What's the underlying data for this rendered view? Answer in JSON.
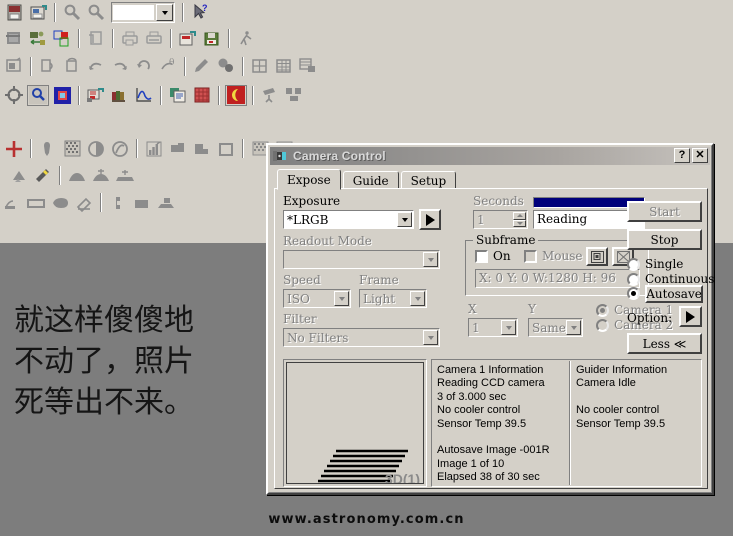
{
  "workspace": {
    "note_text": "就这样傻傻地\n不动了，照片\n死等出不来。",
    "watermark": "www.astronomy.com.cn"
  },
  "toolbar": {
    "rows": [
      {
        "items": [
          {
            "icon": "open-image-icon",
            "type": "btn"
          },
          {
            "icon": "save-image-icon",
            "type": "btn"
          },
          {
            "icon": "sep",
            "type": "sep"
          },
          {
            "icon": "zoom-out-icon",
            "type": "btn"
          },
          {
            "icon": "zoom-in-icon",
            "type": "btn"
          },
          {
            "icon": "zoom-level-combo",
            "type": "combo",
            "value": ""
          },
          {
            "icon": "sep",
            "type": "sep"
          },
          {
            "icon": "context-help-icon",
            "type": "btn"
          }
        ]
      },
      {
        "items": [
          {
            "icon": "film-strip-icon",
            "type": "btn"
          },
          {
            "icon": "camera-transfer-icon",
            "type": "btn"
          },
          {
            "icon": "color-combine-icon",
            "type": "btn"
          },
          {
            "icon": "sep",
            "type": "sep"
          },
          {
            "icon": "copy-page-icon",
            "type": "btn"
          },
          {
            "icon": "sep",
            "type": "sep"
          },
          {
            "icon": "print-setup-icon",
            "type": "btn"
          },
          {
            "icon": "print-icon",
            "type": "btn"
          },
          {
            "icon": "sep",
            "type": "sep"
          },
          {
            "icon": "open-fits-icon",
            "type": "btn"
          },
          {
            "icon": "floppy-save-icon",
            "type": "btn"
          },
          {
            "icon": "sep",
            "type": "sep"
          },
          {
            "icon": "run-script-icon",
            "type": "btn"
          }
        ]
      },
      {
        "items": [
          {
            "icon": "window-image-icon",
            "type": "btn"
          },
          {
            "icon": "sep",
            "type": "sep"
          },
          {
            "icon": "flip-horizontal-icon",
            "type": "btn"
          },
          {
            "icon": "flip-vertical-icon",
            "type": "btn"
          },
          {
            "icon": "rotate-left-icon",
            "type": "btn"
          },
          {
            "icon": "rotate-right-icon",
            "type": "btn"
          },
          {
            "icon": "rotate-180-icon",
            "type": "btn"
          },
          {
            "icon": "rotate-angle-icon",
            "type": "btn"
          },
          {
            "icon": "sep",
            "type": "sep"
          },
          {
            "icon": "pencil-icon",
            "type": "btn"
          },
          {
            "icon": "palette-icon",
            "type": "btn"
          },
          {
            "icon": "sep",
            "type": "sep"
          },
          {
            "icon": "grid-overlay-icon",
            "type": "btn"
          },
          {
            "icon": "table-icon",
            "type": "btn"
          },
          {
            "icon": "report-icon",
            "type": "btn"
          }
        ]
      },
      {
        "items": [
          {
            "icon": "crosshair-icon",
            "type": "btn"
          },
          {
            "icon": "magnify-blue-icon",
            "type": "btn"
          },
          {
            "icon": "target-box-icon",
            "type": "btn"
          },
          {
            "icon": "sep",
            "type": "sep"
          },
          {
            "icon": "camera-control-icon",
            "type": "btn"
          },
          {
            "icon": "library-icon",
            "type": "btn"
          },
          {
            "icon": "graph-curve-icon",
            "type": "btn"
          },
          {
            "icon": "sep",
            "type": "sep"
          },
          {
            "icon": "catalog-icon",
            "type": "btn"
          },
          {
            "icon": "red-grid-icon",
            "type": "btn"
          },
          {
            "icon": "sep",
            "type": "sep"
          },
          {
            "icon": "moon-icon",
            "type": "btn"
          },
          {
            "icon": "sep",
            "type": "sep"
          },
          {
            "icon": "telescope-icon",
            "type": "btn"
          },
          {
            "icon": "observatory-icon",
            "type": "btn"
          }
        ]
      },
      {
        "items": [
          {
            "icon": "red-plus-icon",
            "type": "btn"
          },
          {
            "icon": "sep",
            "type": "sep"
          },
          {
            "icon": "dropper-icon",
            "type": "btn"
          },
          {
            "icon": "noise-grid-icon",
            "type": "btn"
          },
          {
            "icon": "half-circle-icon",
            "type": "btn"
          },
          {
            "icon": "circle-slash-icon",
            "type": "btn"
          },
          {
            "icon": "sep",
            "type": "sep"
          },
          {
            "icon": "histogram-icon",
            "type": "btn"
          },
          {
            "icon": "shape-poly-icon",
            "type": "btn"
          },
          {
            "icon": "shape-corner-icon",
            "type": "btn"
          },
          {
            "icon": "square-outline-icon",
            "type": "btn"
          },
          {
            "icon": "sep",
            "type": "sep"
          },
          {
            "icon": "checker-icon",
            "type": "btn"
          },
          {
            "icon": "checker2-icon",
            "type": "btn"
          }
        ]
      },
      {
        "items": [
          {
            "icon": "mountain-arrow-icon",
            "type": "btn"
          },
          {
            "icon": "wand-icon",
            "type": "btn"
          },
          {
            "icon": "sep",
            "type": "sep"
          },
          {
            "icon": "hill-icon",
            "type": "btn"
          },
          {
            "icon": "hill-star-icon",
            "type": "btn"
          },
          {
            "icon": "flat-star-icon",
            "type": "btn"
          }
        ]
      },
      {
        "items": [
          {
            "icon": "align-stack-icon",
            "type": "btn"
          },
          {
            "icon": "rect-frame-icon",
            "type": "btn"
          },
          {
            "icon": "blob-icon",
            "type": "btn"
          },
          {
            "icon": "eraser-icon",
            "type": "btn"
          },
          {
            "icon": "sep",
            "type": "sep"
          },
          {
            "icon": "bracket-icon",
            "type": "btn"
          },
          {
            "icon": "filled-rect-icon",
            "type": "btn"
          },
          {
            "icon": "stack-out-icon",
            "type": "btn"
          }
        ]
      }
    ]
  },
  "dialog": {
    "title": "Camera Control",
    "title_icon": "camera-control-icon",
    "help_button": "?",
    "close_button": "✕",
    "tabs": [
      {
        "label": "Expose",
        "active": true
      },
      {
        "label": "Guide",
        "active": false
      },
      {
        "label": "Setup",
        "active": false
      }
    ],
    "expose": {
      "exposure_label": "Exposure",
      "exposure_value": "*LRGB",
      "exposure_arrow_icon": "play-arrow-icon",
      "readout_label": "Readout Mode",
      "readout_value": "",
      "speed_label": "Speed",
      "speed_value": "ISO",
      "frame_label": "Frame",
      "frame_value": "Light",
      "filter_label": "Filter",
      "filter_value": "No Filters",
      "seconds_label": "Seconds",
      "seconds_value": "1",
      "progress_percent": 100,
      "progress_color": "#00007b",
      "status_value": "Reading",
      "subframe_label": "Subframe",
      "subframe_on_label": "On",
      "subframe_on_checked": false,
      "subframe_mouse_label": "Mouse",
      "subframe_mouse_checked": false,
      "subframe_pick_icon": "subframe-pick-icon",
      "subframe_full_icon": "subframe-full-icon",
      "subframe_coords": "X:    0 Y:    0 W:1280 H:  96",
      "bin_x_label": "X",
      "bin_x_value": "1",
      "bin_y_label": "Y",
      "bin_y_value": "Same",
      "camera1_label": "Camera 1",
      "camera2_label": "Camera 2",
      "camera_selected": "Camera 1",
      "start_label": "Start",
      "start_enabled": false,
      "stop_label": "Stop",
      "stop_enabled": true,
      "mode_single_label": "Single",
      "mode_continuous_label": "Continuous",
      "mode_autosave_label": "Autosave",
      "mode_selected": "Autosave",
      "options_label": "Option:",
      "options_arrow_icon": "play-arrow-icon",
      "less_label": "Less ≪"
    },
    "preview": {
      "label": "3D(1)"
    },
    "camera_info": {
      "heading": "Camera 1 Information",
      "lines": "Camera 1 Information\nReading CCD camera\n3 of 3.000 sec\nNo cooler control\nSensor Temp 39.5\n\nAutosave Image -001R\nImage 1 of 10\nElapsed 38 of 30 sec"
    },
    "guider_info": {
      "heading": "Guider Information",
      "lines": "Guider Information\nCamera Idle\n\nNo cooler control\nSensor Temp 39.5"
    }
  }
}
